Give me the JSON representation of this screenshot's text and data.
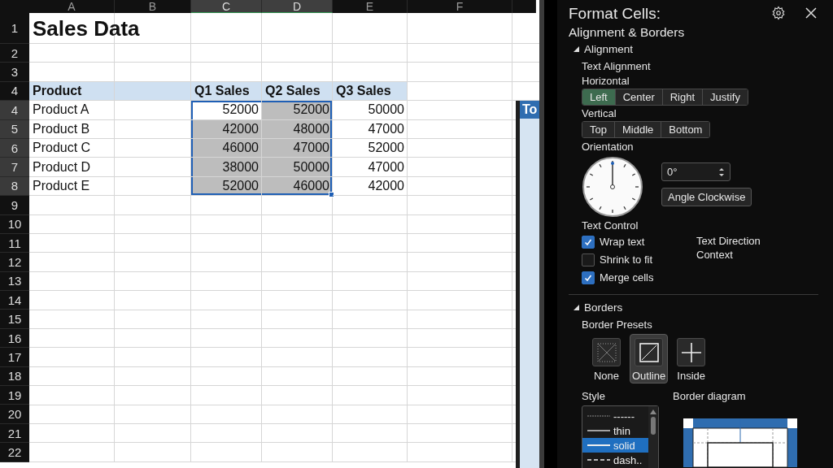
{
  "sheet": {
    "columns": [
      {
        "label": "A",
        "selected": false
      },
      {
        "label": "B",
        "selected": false
      },
      {
        "label": "C",
        "selected": true
      },
      {
        "label": "D",
        "selected": true
      },
      {
        "label": "E",
        "selected": false
      },
      {
        "label": "F",
        "selected": false
      }
    ],
    "rows": [
      {
        "header": "1",
        "kind": "title",
        "cells": {
          "A": {
            "text": "Sales Data"
          }
        }
      },
      {
        "header": "2",
        "kind": "blank"
      },
      {
        "header": "3",
        "kind": "blank"
      },
      {
        "header": "4",
        "kind": "header",
        "cells": {
          "A": {
            "text": "Product"
          },
          "C": {
            "text": "Q1 Sales"
          },
          "D": {
            "text": "Q2 Sales"
          },
          "E": {
            "text": "Q3 Sales"
          }
        }
      },
      {
        "header": "4",
        "kind": "data",
        "cells": {
          "A": {
            "text": "Product A",
            "selected": false,
            "active": false
          },
          "C": {
            "text": "52000",
            "selected": true,
            "active": true
          },
          "D": {
            "text": "52000",
            "selected": true,
            "active": false
          },
          "E": {
            "text": "50000",
            "selected": false,
            "active": false
          }
        }
      },
      {
        "header": "5",
        "kind": "data",
        "cells": {
          "A": {
            "text": "Product B",
            "selected": false,
            "active": false
          },
          "C": {
            "text": "42000",
            "selected": true,
            "active": false
          },
          "D": {
            "text": "48000",
            "selected": true,
            "active": false
          },
          "E": {
            "text": "47000",
            "selected": false,
            "active": false
          }
        }
      },
      {
        "header": "6",
        "kind": "data",
        "cells": {
          "A": {
            "text": "Product C",
            "selected": false,
            "active": false
          },
          "C": {
            "text": "46000",
            "selected": true,
            "active": false
          },
          "D": {
            "text": "47000",
            "selected": true,
            "active": false
          },
          "E": {
            "text": "52000",
            "selected": false,
            "active": false
          }
        }
      },
      {
        "header": "7",
        "kind": "data",
        "cells": {
          "A": {
            "text": "Product D",
            "selected": false,
            "active": false
          },
          "C": {
            "text": "38000",
            "selected": true,
            "active": false
          },
          "D": {
            "text": "50000",
            "selected": true,
            "active": false
          },
          "E": {
            "text": "47000",
            "selected": false,
            "active": false
          }
        }
      },
      {
        "header": "8",
        "kind": "data",
        "cells": {
          "A": {
            "text": "Product E",
            "selected": false,
            "active": false
          },
          "C": {
            "text": "52000",
            "selected": true,
            "active": false
          },
          "D": {
            "text": "46000",
            "selected": true,
            "active": false
          },
          "E": {
            "text": "42000",
            "selected": false,
            "active": false
          }
        }
      },
      {
        "header": "9",
        "kind": "blank"
      },
      {
        "header": "10",
        "kind": "blank"
      },
      {
        "header": "11",
        "kind": "blank"
      },
      {
        "header": "12",
        "kind": "blank"
      },
      {
        "header": "13",
        "kind": "blank"
      },
      {
        "header": "14",
        "kind": "blank"
      },
      {
        "header": "15",
        "kind": "blank"
      },
      {
        "header": "16",
        "kind": "blank"
      },
      {
        "header": "17",
        "kind": "blank"
      },
      {
        "header": "18",
        "kind": "blank"
      },
      {
        "header": "19",
        "kind": "blank"
      },
      {
        "header": "20",
        "kind": "blank"
      },
      {
        "header": "21",
        "kind": "blank"
      },
      {
        "header": "22",
        "kind": "blank"
      }
    ],
    "side_table": {
      "header": "To"
    }
  },
  "panel": {
    "title": "Format Cells:",
    "subtitle": "Alignment & Borders",
    "alignment": {
      "title": "Alignment",
      "expanded": true,
      "text_alignment_label": "Text Alignment",
      "horizontal_label": "Horizontal",
      "horizontal_options": [
        {
          "label": "Left",
          "selected": true
        },
        {
          "label": "Center",
          "selected": false
        },
        {
          "label": "Right",
          "selected": false
        },
        {
          "label": "Justify",
          "selected": false
        }
      ],
      "vertical_label": "Vertical",
      "vertical_options": [
        {
          "label": "Top",
          "selected": false
        },
        {
          "label": "Middle",
          "selected": false
        },
        {
          "label": "Bottom",
          "selected": false
        }
      ],
      "orientation_label": "Orientation",
      "angle_value": "0°",
      "angle_button": "Angle Clockwise",
      "text_control_label": "Text Control",
      "checkboxes": [
        {
          "label": "Wrap text",
          "checked": true
        },
        {
          "label": "Shrink to fit",
          "checked": false
        },
        {
          "label": "Merge cells",
          "checked": true
        }
      ],
      "text_direction_label": "Text Direction",
      "text_direction_value": "Context"
    },
    "borders": {
      "title": "Borders",
      "expanded": true,
      "presets_label": "Border Presets",
      "presets": [
        {
          "label": "None",
          "kind": "none",
          "selected": false
        },
        {
          "label": "Outline",
          "kind": "outline",
          "selected": true
        },
        {
          "label": "Inside",
          "kind": "inside",
          "selected": false
        }
      ],
      "style_label": "Style",
      "styles": [
        {
          "label": "------",
          "kind": "dotted",
          "selected": false
        },
        {
          "label": "thin",
          "kind": "thin",
          "selected": false
        },
        {
          "label": "solid",
          "kind": "solid",
          "selected": true
        },
        {
          "label": "dash..",
          "kind": "dashed",
          "selected": false
        }
      ],
      "diagram_label": "Border diagram"
    }
  }
}
